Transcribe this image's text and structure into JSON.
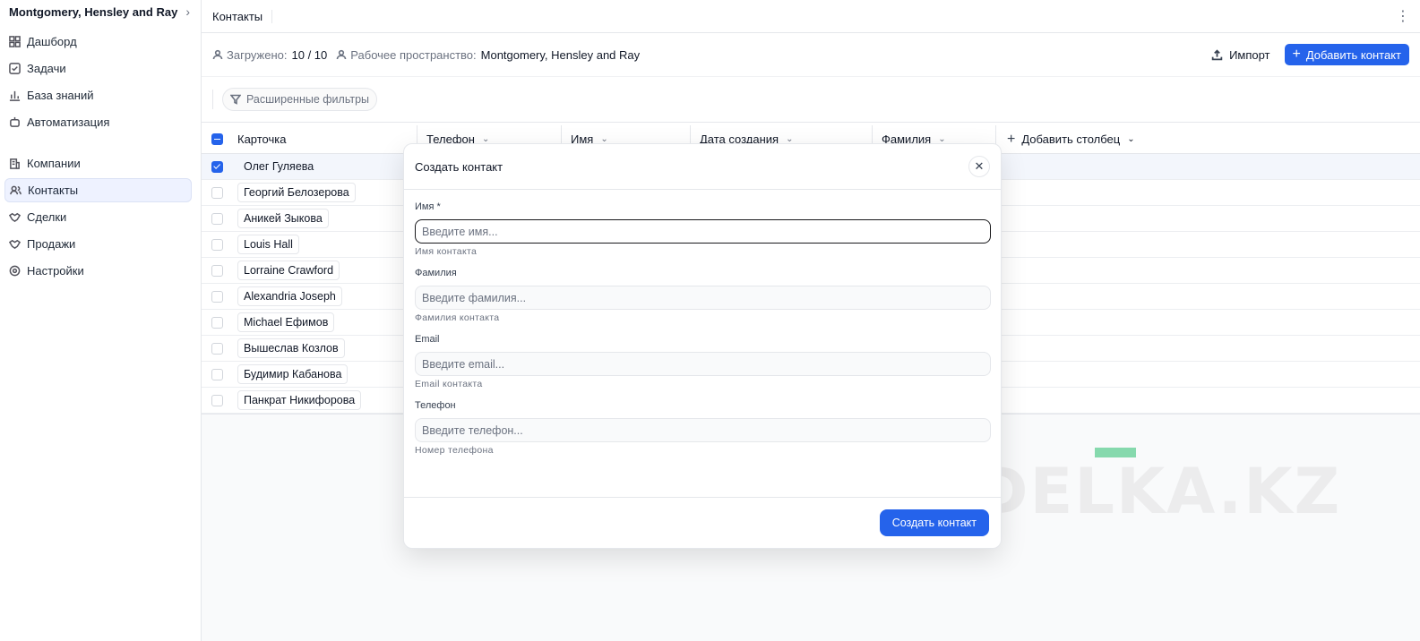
{
  "sidebar": {
    "workspace": "Montgomery, Hensley and Ray",
    "items_top": [
      {
        "label": "Дашборд",
        "icon": "dashboard-icon"
      },
      {
        "label": "Задачи",
        "icon": "tasks-icon"
      },
      {
        "label": "База знаний",
        "icon": "knowledge-base-icon"
      },
      {
        "label": "Автоматизация",
        "icon": "automation-icon"
      }
    ],
    "items_bottom": [
      {
        "label": "Компании",
        "icon": "companies-icon"
      },
      {
        "label": "Контакты",
        "icon": "contacts-icon",
        "active": true
      },
      {
        "label": "Сделки",
        "icon": "deals-icon"
      },
      {
        "label": "Продажи",
        "icon": "sales-icon"
      },
      {
        "label": "Настройки",
        "icon": "settings-icon"
      }
    ]
  },
  "header": {
    "breadcrumb": "Контакты"
  },
  "info": {
    "loaded_label": "Загружено:",
    "loaded_value": "10 / 10",
    "workspace_label": "Рабочее пространство:",
    "workspace_value": "Montgomery, Hensley and Ray",
    "import_label": "Импорт",
    "add_contact_label": "Добавить контакт"
  },
  "filters": {
    "advanced_label": "Расширенные фильтры"
  },
  "table": {
    "columns": [
      "Карточка",
      "Телефон",
      "Имя",
      "Дата создания",
      "Фамилия"
    ],
    "add_column_label": "Добавить столбец",
    "rows": [
      {
        "name": "Олег Гуляева",
        "checked": true
      },
      {
        "name": "Георгий Белозерова",
        "checked": false
      },
      {
        "name": "Аникей Зыкова",
        "checked": false
      },
      {
        "name": "Louis Hall",
        "checked": false
      },
      {
        "name": "Lorraine Crawford",
        "checked": false
      },
      {
        "name": "Alexandria Joseph",
        "checked": false
      },
      {
        "name": "Michael Ефимов",
        "checked": false
      },
      {
        "name": "Вышеслав Козлов",
        "checked": false
      },
      {
        "name": "Будимир Кабанова",
        "checked": false
      },
      {
        "name": "Панкрат Никифорова",
        "checked": false
      }
    ]
  },
  "watermark": "SDELKA.KZ",
  "modal": {
    "title": "Создать контакт",
    "fields": [
      {
        "label": "Имя *",
        "placeholder": "Введите имя...",
        "help": "Имя контакта"
      },
      {
        "label": "Фамилия",
        "placeholder": "Введите фамилия...",
        "help": "Фамилия контакта"
      },
      {
        "label": "Email",
        "placeholder": "Введите email...",
        "help": "Email контакта"
      },
      {
        "label": "Телефон",
        "placeholder": "Введите телефон...",
        "help": "Номер телефона"
      }
    ],
    "submit_label": "Создать контакт"
  },
  "colors": {
    "accent": "#2563eb",
    "watermark_bar": "#86d9ad"
  }
}
